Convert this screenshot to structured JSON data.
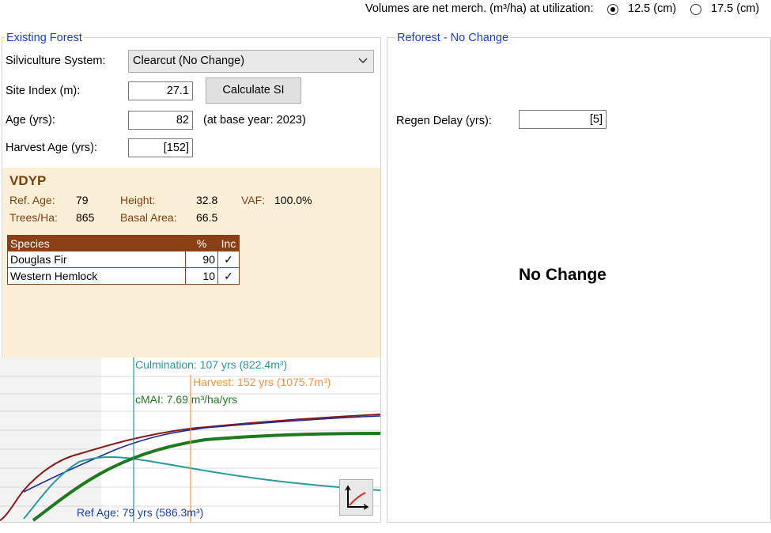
{
  "topbar": {
    "label": "Volumes are net merch. (m³/ha) at utilization:",
    "options": [
      {
        "label": "12.5 (cm)",
        "selected": true
      },
      {
        "label": "17.5 (cm)",
        "selected": false
      }
    ]
  },
  "existing_forest": {
    "title": "Existing Forest",
    "silviculture_label": "Silviculture System:",
    "silviculture_value": "Clearcut (No Change)",
    "site_index_label": "Site Index (m):",
    "site_index_value": "27.1",
    "calc_si_button": "Calculate SI",
    "age_label": "Age (yrs):",
    "age_value": "82",
    "base_year_note": "(at base year: 2023)",
    "harvest_age_label": "Harvest Age (yrs):",
    "harvest_age_value": "[152]"
  },
  "vdyp": {
    "title": "VDYP",
    "ref_age_label": "Ref. Age:",
    "ref_age_value": "79",
    "height_label": "Height:",
    "height_value": "32.8",
    "vaf_label": "VAF:",
    "vaf_value": "100.0%",
    "trees_label": "Trees/Ha:",
    "trees_value": "865",
    "basal_label": "Basal Area:",
    "basal_value": "66.5",
    "species_headers": {
      "species": "Species",
      "pct": "%",
      "inc": "Inc"
    },
    "species": [
      {
        "name": "Douglas Fir",
        "pct": "90",
        "inc": "✓"
      },
      {
        "name": "Western Hemlock",
        "pct": "10",
        "inc": "✓"
      }
    ]
  },
  "chart": {
    "culmination_label": "Culmination: 107 yrs (822.4m³)",
    "harvest_label": "Harvest: 152 yrs (1075.7m³)",
    "cmai_label": "cMAI: 7.69 m³/ha/yrs",
    "ref_age_label": "Ref Age: 79 yrs (586.3m³)",
    "icon": "chart-axes-icon",
    "colors": {
      "culmination": "#2a9a9a",
      "harvest": "#f0923a",
      "cmai": "#1f7a1f",
      "ref_age": "#1a3fa8"
    }
  },
  "reforest": {
    "title": "Reforest - No Change",
    "regen_delay_label": "Regen Delay (yrs):",
    "regen_delay_value": "[5]",
    "status": "No Change"
  }
}
